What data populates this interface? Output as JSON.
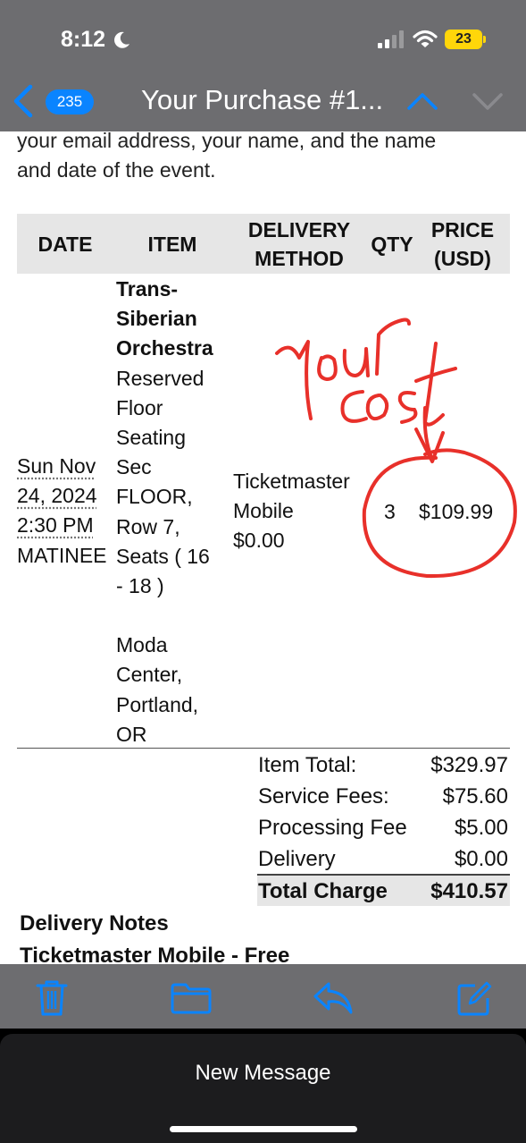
{
  "status_bar": {
    "time": "8:12",
    "battery": "23"
  },
  "nav": {
    "unread_count": "235",
    "subject": "Your Purchase #1..."
  },
  "intro_lines": [
    "your email address, your name, and the name",
    "and date of the event."
  ],
  "table": {
    "headers": {
      "date": "DATE",
      "item": "ITEM",
      "delivery_1": "DELIVERY",
      "delivery_2": "METHOD",
      "qty": "QTY",
      "price_1": "PRICE",
      "price_2": "(USD)"
    },
    "row": {
      "date_lines": [
        "Sun Nov",
        "24, 2024",
        "2:30 PM",
        "MATINEE"
      ],
      "item_title_lines": [
        "Trans-",
        "Siberian",
        "Orchestra"
      ],
      "item_detail_lines": [
        "Reserved",
        "Floor",
        "Seating",
        "Sec",
        "FLOOR,",
        "Row 7,",
        "Seats ( 16",
        "- 18 )"
      ],
      "venue_lines": [
        "Moda",
        "Center,",
        "Portland,",
        "OR"
      ],
      "delivery_lines": [
        "Ticketmaster",
        "Mobile",
        "$0.00"
      ],
      "qty": "3",
      "price": "$109.99"
    }
  },
  "summary": {
    "item_total_label": "Item Total:",
    "item_total": "$329.97",
    "service_fees_label": "Service Fees:",
    "service_fees": "$75.60",
    "processing_fee_label": "Processing Fee",
    "processing_fee": "$5.00",
    "delivery_label": "Delivery",
    "delivery": "$0.00",
    "total_label": "Total Charge",
    "total": "$410.57"
  },
  "delivery_notes": {
    "heading": "Delivery Notes",
    "method": "Ticketmaster Mobile - Free"
  },
  "annotation": {
    "line1": "Your",
    "line2": "cost",
    "color": "#e8302a"
  },
  "toolbar": {
    "icons": [
      "trash-icon",
      "folder-icon",
      "reply-icon",
      "compose-icon"
    ]
  },
  "bottom_sheet": {
    "label": "New Message"
  },
  "colors": {
    "accent": "#0a84ff",
    "chrome": "#6d6d70",
    "header_row": "#e6e6e6"
  }
}
